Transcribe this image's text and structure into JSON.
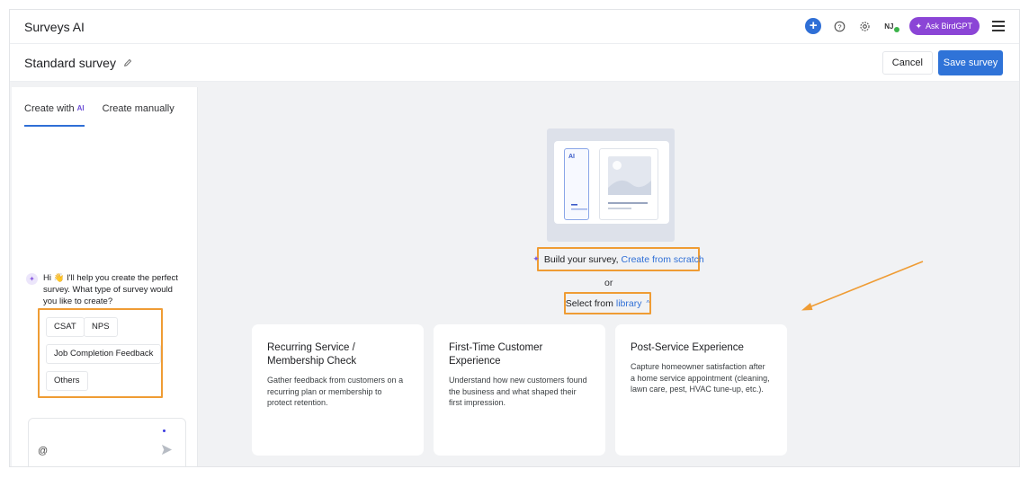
{
  "app": {
    "title": "Surveys AI",
    "user_initials": "NJ",
    "ask_label": "Ask BirdGPT"
  },
  "header": {
    "survey_name": "Standard survey",
    "cancel_label": "Cancel",
    "save_label": "Save survey"
  },
  "left_panel": {
    "tabs": [
      {
        "label": "Create with",
        "badge": "AI",
        "active": true
      },
      {
        "label": "Create manually",
        "active": false
      }
    ],
    "chat_message": "Hi 👋 I'll help you create the perfect survey. What type of survey would you like to create?",
    "options": [
      "CSAT",
      "NPS",
      "Job Completion Feedback",
      "Others"
    ]
  },
  "center": {
    "illustration_badge": "AI",
    "build_prefix": "Build your survey,",
    "build_link": "Create from scratch",
    "or_text": "or",
    "select_prefix": "Select from",
    "select_link": "library"
  },
  "cards": [
    {
      "title": "Recurring Service / Membership Check",
      "description": "Gather feedback from customers on a recurring plan or membership to protect retention."
    },
    {
      "title": "First-Time Customer Experience",
      "description": "Understand how new customers found the business and what shaped their first impression."
    },
    {
      "title": "Post-Service Experience",
      "description": "Capture homeowner satisfaction after a home service appointment (cleaning, lawn care, pest, HVAC tune-up, etc.)."
    }
  ],
  "colors": {
    "primary": "#2f73d8",
    "accent_purple": "#8b45d6",
    "highlight_orange": "#ef9c34",
    "background": "#f1f2f4"
  },
  "icons": {
    "add": "plus-circle-icon",
    "help": "question-circle-icon",
    "settings": "gear-icon",
    "menu": "hamburger-menu-icon",
    "edit": "pencil-icon",
    "attach": "at-sign-icon",
    "send": "send-arrow-icon"
  }
}
